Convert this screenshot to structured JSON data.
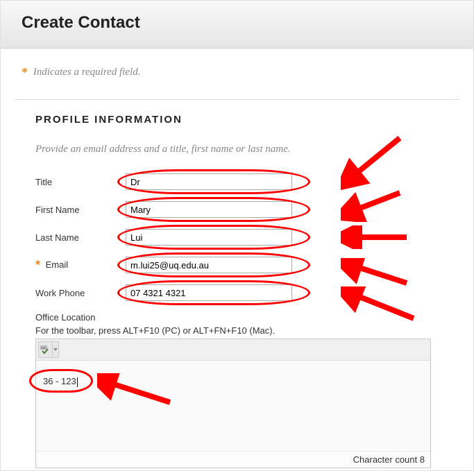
{
  "header": {
    "title": "Create Contact"
  },
  "required_note": "Indicates a required field.",
  "section": {
    "title": "PROFILE INFORMATION",
    "desc": "Provide an email address and a title, first name or last name."
  },
  "fields": {
    "title": {
      "label": "Title",
      "value": "Dr"
    },
    "first_name": {
      "label": "First Name",
      "value": "Mary"
    },
    "last_name": {
      "label": "Last Name",
      "value": "Lui"
    },
    "email": {
      "label": "Email",
      "value": "m.lui25@uq.edu.au"
    },
    "work_phone": {
      "label": "Work Phone",
      "value": "07 4321 4321"
    }
  },
  "office": {
    "label": "Office Location",
    "toolbar_hint": "For the toolbar, press ALT+F10 (PC) or ALT+FN+F10 (Mac).",
    "value": "36 - 123",
    "char_count_label": "Character count",
    "char_count": 8
  }
}
